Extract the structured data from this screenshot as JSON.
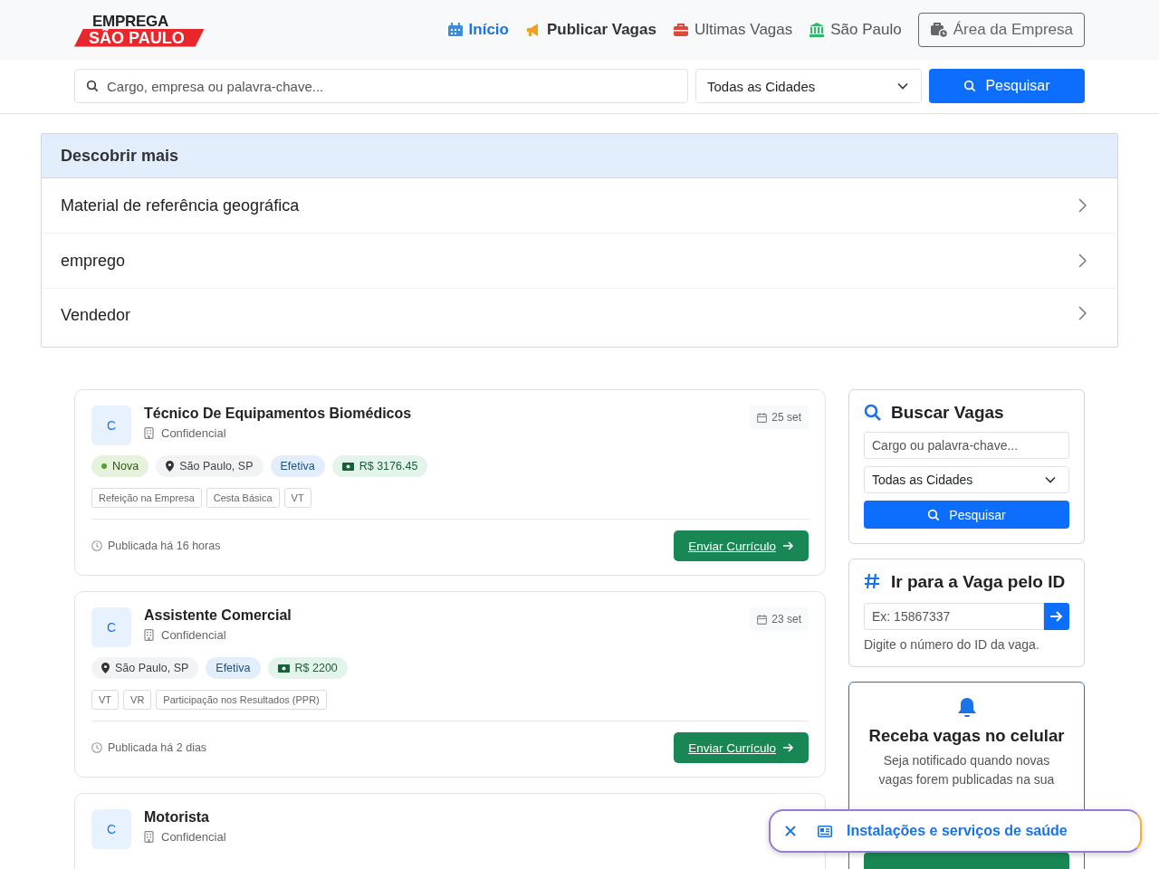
{
  "logo": {
    "line1": "EMPREGA",
    "line2": "SÃO PAULO"
  },
  "nav": [
    {
      "label": "Início",
      "kind": "calendar",
      "selected": true,
      "bold": true
    },
    {
      "label": "Publicar Vagas",
      "kind": "megaphone",
      "selected": false,
      "bold": true
    },
    {
      "label": "Ultimas Vagas",
      "kind": "briefcase",
      "selected": false,
      "bold": false
    },
    {
      "label": "São Paulo",
      "kind": "bank",
      "selected": false,
      "bold": false
    }
  ],
  "company_area": {
    "label": "Área da Empresa"
  },
  "search": {
    "placeholder": "Cargo, empresa ou palavra-chave...",
    "city": "Todas as Cidades",
    "button": "Pesquisar"
  },
  "discover": {
    "title": "Descobrir mais",
    "items": [
      "Material de referência geográfica",
      "emprego",
      "Vendedor"
    ]
  },
  "jobs": [
    {
      "initial": "C",
      "title": "Técnico De Equipamentos Biomédicos",
      "company": "Confidencial",
      "date": "25 set",
      "chips": [
        {
          "kind": "status",
          "text": "Nova"
        },
        {
          "kind": "location",
          "text": "São Paulo, SP"
        },
        {
          "kind": "contract",
          "text": "Efetiva"
        },
        {
          "kind": "salary",
          "text": "R$ 3176.45"
        }
      ],
      "benefits": [
        "Refeição na Empresa",
        "Cesta Básica",
        "VT"
      ],
      "posted": "Publicada há 16 horas",
      "button": "Enviar Currículo"
    },
    {
      "initial": "C",
      "title": "Assistente Comercial",
      "company": "Confidencial",
      "date": "23 set",
      "chips": [
        {
          "kind": "location",
          "text": "São Paulo, SP"
        },
        {
          "kind": "contract",
          "text": "Efetiva"
        },
        {
          "kind": "salary",
          "text": "R$ 2200"
        }
      ],
      "benefits": [
        "VT",
        "VR",
        "Participação nos Resultados (PPR)"
      ],
      "posted": "Publicada há 2 dias",
      "button": "Enviar Currículo"
    },
    {
      "initial": "C",
      "title": "Motorista",
      "company": "Confidencial"
    }
  ],
  "sidebar": {
    "search": {
      "title": "Buscar Vagas",
      "placeholder": "Cargo ou palavra-chave...",
      "city": "Todas as Cidades",
      "button": "Pesquisar"
    },
    "goto": {
      "title": "Ir para a Vaga pelo ID",
      "placeholder": "Ex: 15867337",
      "hint": "Digite o número do ID da vaga."
    },
    "notify": {
      "title": "Receba vagas no celular",
      "text": "Seja notificado quando novas vagas forem publicadas na sua"
    }
  },
  "popup": {
    "label": "Instalações e serviços de saúde"
  }
}
